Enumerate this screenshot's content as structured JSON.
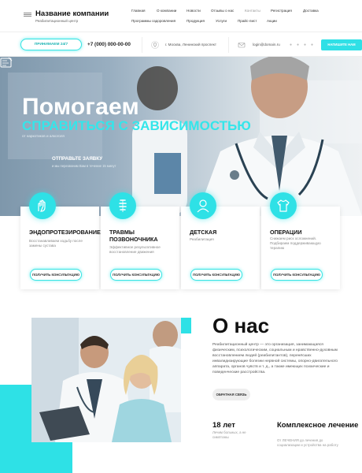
{
  "header": {
    "company_name": "Название компании",
    "company_subtitle": "Реабилитационный центр",
    "nav": [
      {
        "label": "Главная"
      },
      {
        "label": "О компании"
      },
      {
        "label": "Новости"
      },
      {
        "label": "Отзывы о нас"
      },
      {
        "label": "Контакты"
      },
      {
        "label": "Регистрация"
      },
      {
        "label": "Доставка"
      },
      {
        "label": "Программы оздоровления"
      },
      {
        "label": "Продукция"
      },
      {
        "label": "Услуги"
      },
      {
        "label": "Прайс-лист"
      },
      {
        "label": "Акции"
      }
    ]
  },
  "contacts": {
    "badge": "ПРИНИМАЕМ 24/7",
    "phone": "+7 (000) 000-00-00",
    "address": "г. Москва, Ленинский проспект",
    "email": "login@domain.ru",
    "write_button": "НАПИШИТЕ НАМ",
    "social_icons": [
      "vk-icon",
      "facebook-icon",
      "twitter-icon",
      "instagram-icon"
    ]
  },
  "hero": {
    "title": "Помогаем",
    "subtitle": "справиться с зависимостью",
    "small": "от наркотиков и алкоголя",
    "request_title": "ОТПРАВЬТЕ ЗАЯВКУ",
    "request_sub": "и мы перезвоним Вам в течение 15 минут"
  },
  "services": [
    {
      "title": "ЭНДОПРОТЕЗИРОВАНИЕ",
      "desc": "Восстанавливаем ходьбу после замены сустава",
      "button": "ПОЛУЧИТЬ КОНСУЛЬТАЦИЮ",
      "icon": "hand-icon"
    },
    {
      "title": "ТРАВМЫ ПОЗВОНОЧНИКА",
      "desc": "Эффективное результативное восстановление движения",
      "button": "ПОЛУЧИТЬ КОНСУЛЬТАЦИЮ",
      "icon": "spine-icon"
    },
    {
      "title": "ДЕТСКАЯ",
      "desc": "Реабилитация",
      "button": "ПОЛУЧИТЬ КОНСУЛЬТАЦИЮ",
      "icon": "child-icon"
    },
    {
      "title": "ОПЕРАЦИИ",
      "desc": "Снижаем риск осложнений. Подбираем поддерживающую терапию",
      "button": "ПОЛУЧИТЬ КОНСУЛЬТАЦИЮ",
      "icon": "shirt-icon"
    }
  ],
  "about": {
    "title": "О нас",
    "text": "Реабилитационный центр — это организация, занимающаяся физическим, психологическим, социальным и нравственно-духовным восстановлением людей (реабилитантов), перенёсших инвалидизирующие болезни нервной системы, опорно-двигательного аппарата, органов чувств и т. д., а также имеющих психические и поведенческие расстройства.",
    "button": "ОБРАТНАЯ СВЯЗЬ",
    "stats": [
      {
        "num": "18 лет",
        "desc": "Лечим больных, а не симптомы"
      },
      {
        "num": "Комплексное лечение",
        "desc": "От ЛЕЧЕНИЯ до лечения до социализации и устройства на работу"
      }
    ]
  },
  "colors": {
    "accent": "#2ee1e6",
    "text": "#111111"
  }
}
